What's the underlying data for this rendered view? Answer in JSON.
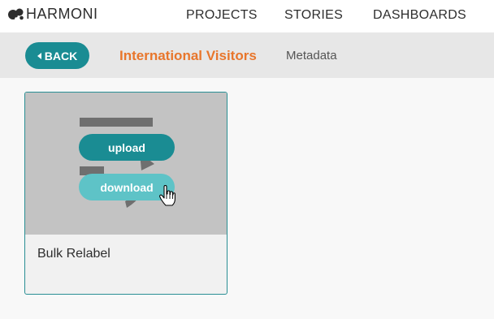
{
  "app": {
    "brand_name": "HARMONI",
    "logo_icon": "harmoni-logo-icon"
  },
  "nav": {
    "items": [
      {
        "label": "PROJECTS"
      },
      {
        "label": "STORIES"
      },
      {
        "label": "DASHBOARDS"
      }
    ]
  },
  "subheader": {
    "back_label": "BACK",
    "back_icon": "caret-left-icon",
    "breadcrumb_active": "International Visitors",
    "breadcrumb_section": "Metadata"
  },
  "cards": [
    {
      "title": "Bulk Relabel",
      "upload_label": "upload",
      "download_label": "download",
      "icons": [
        "document-icon",
        "hand-pointer-cursor-icon"
      ]
    }
  ],
  "colors": {
    "primary_teal": "#1a8c93",
    "light_teal": "#5ec3c7",
    "accent_orange": "#e8762c",
    "subheader_bg": "#e7e7e7"
  }
}
